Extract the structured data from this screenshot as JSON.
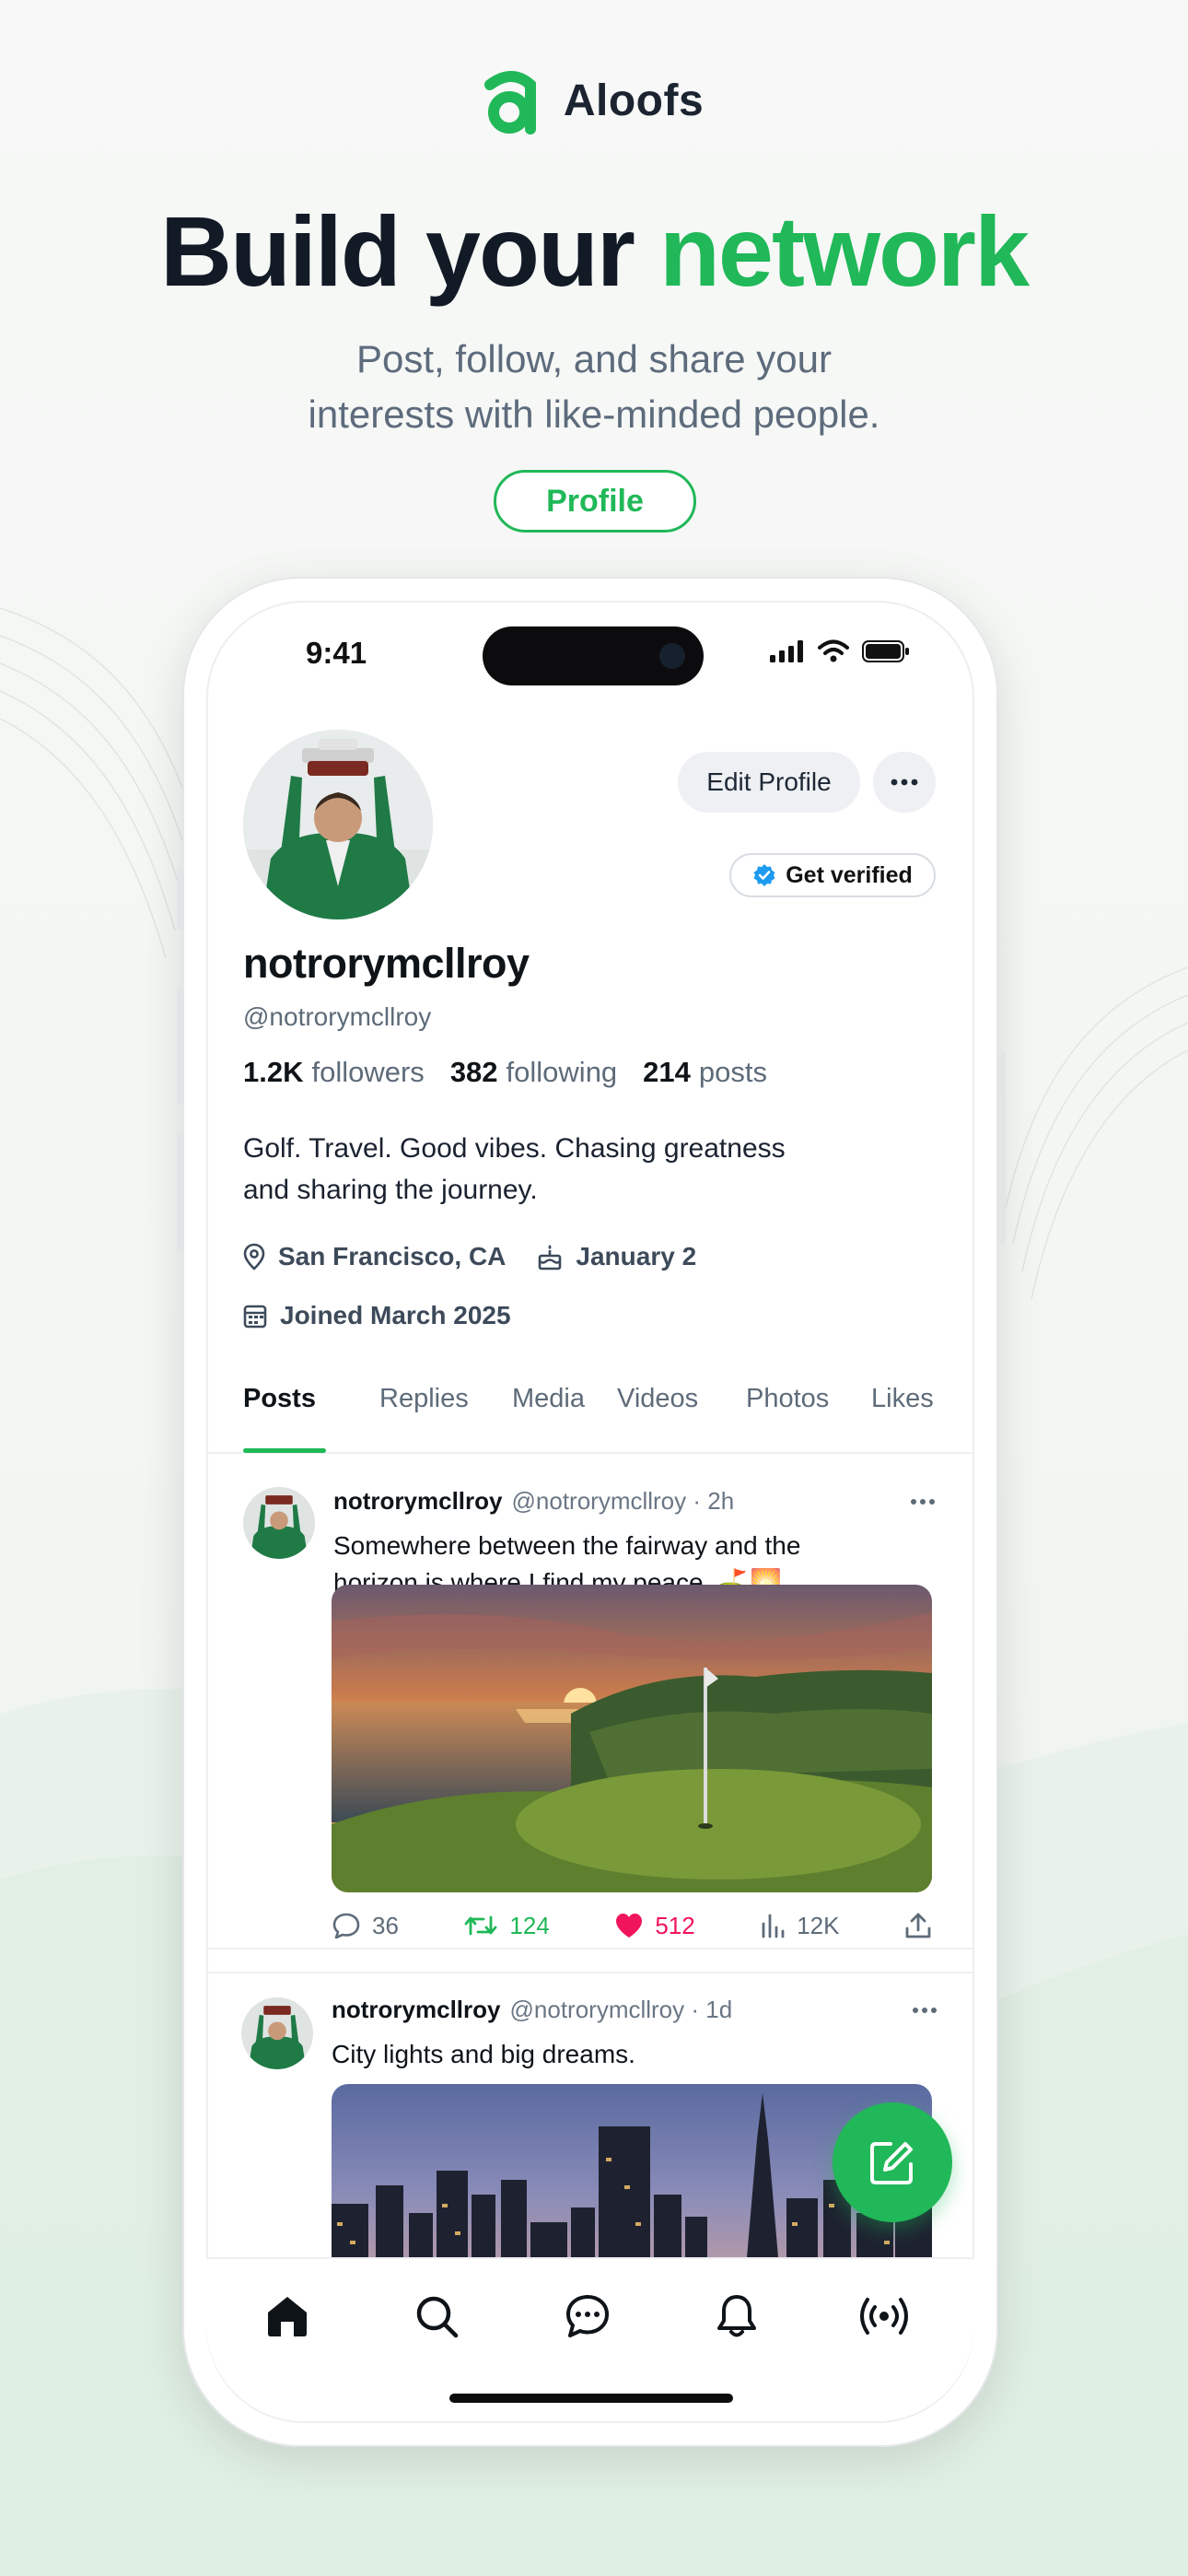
{
  "brand": {
    "name": "Aloofs",
    "accent_color": "#20b858"
  },
  "hero": {
    "headline_part1": "Build your ",
    "headline_accent": "network",
    "subtitle_line1": "Post, follow, and share your",
    "subtitle_line2": "interests with like-minded people.",
    "pill_label": "Profile"
  },
  "status_bar": {
    "time": "9:41"
  },
  "profile": {
    "edit_label": "Edit Profile",
    "verify_label": "Get verified",
    "display_name": "notrorymcllroy",
    "handle": "@notrorymcllroy",
    "stats": [
      {
        "num": "1.2K",
        "label": "followers"
      },
      {
        "num": "382",
        "label": "following"
      },
      {
        "num": "214",
        "label": "posts"
      }
    ],
    "bio_line1": "Golf. Travel. Good vibes. Chasing greatness",
    "bio_line2": "and sharing the journey.",
    "location": "San Francisco, CA",
    "birthday": "January 2",
    "joined": "Joined March 2025"
  },
  "tabs": [
    "Posts",
    "Replies",
    "Media",
    "Videos",
    "Photos",
    "Likes"
  ],
  "posts": [
    {
      "author": "notrorymcllroy",
      "meta": "@notrorymcllroy · 2h",
      "text_line1": "Somewhere between the fairway and the",
      "text_line2": "horizon is where I find my peace. ⛳🌅",
      "replies": "36",
      "reposts": "124",
      "likes": "512",
      "views": "12K"
    },
    {
      "author": "notrorymcllroy",
      "meta": "@notrorymcllroy · 1d",
      "text_line1": "City lights and big dreams."
    }
  ],
  "icons": {
    "nav": [
      "home-icon",
      "search-icon",
      "messages-icon",
      "bell-icon",
      "broadcast-icon"
    ],
    "fab": "compose-icon"
  }
}
